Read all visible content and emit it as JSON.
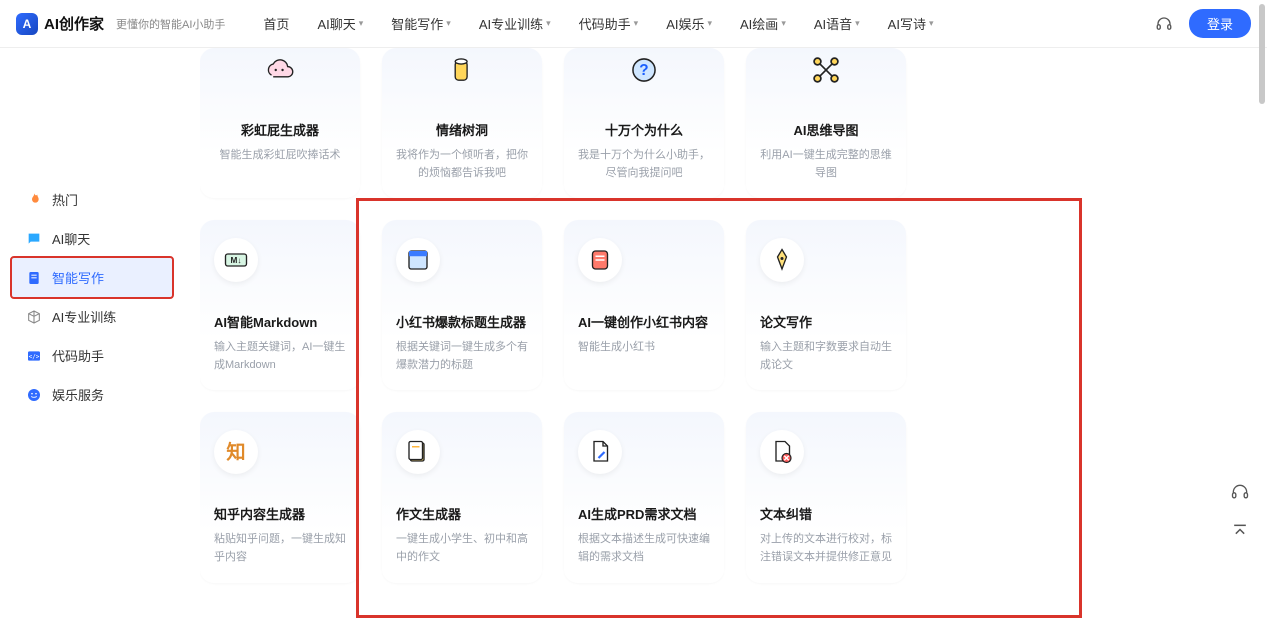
{
  "header": {
    "logo_text": "AI创作家",
    "tagline": "更懂你的智能AI小助手",
    "nav": [
      "首页",
      "AI聊天",
      "智能写作",
      "AI专业训练",
      "代码助手",
      "AI娱乐",
      "AI绘画",
      "AI语音",
      "AI写诗"
    ],
    "nav_has_dropdown": [
      false,
      true,
      true,
      true,
      true,
      true,
      true,
      true,
      true
    ],
    "login": "登录"
  },
  "sidebar": {
    "items": [
      {
        "icon": "fire",
        "label": "热门",
        "color": "#ff8a3d"
      },
      {
        "icon": "chat",
        "label": "AI聊天",
        "color": "#2aa8ff"
      },
      {
        "icon": "doc",
        "label": "智能写作",
        "color": "#2f6bff"
      },
      {
        "icon": "cube",
        "label": "AI专业训练",
        "color": "#888"
      },
      {
        "icon": "code",
        "label": "代码助手",
        "color": "#2f6bff"
      },
      {
        "icon": "smile",
        "label": "娱乐服务",
        "color": "#2f6bff"
      }
    ],
    "active_index": 2
  },
  "rows": [
    [
      {
        "icon": "cloud",
        "title": "彩虹屁生成器",
        "desc": "智能生成彩虹屁吹捧话术"
      },
      {
        "icon": "cup",
        "title": "情绪树洞",
        "desc": "我将作为一个倾听者，把你的烦恼都告诉我吧"
      },
      {
        "icon": "question",
        "title": "十万个为什么",
        "desc": "我是十万个为什么小助手，尽管向我提问吧"
      },
      {
        "icon": "mind",
        "title": "AI思维导图",
        "desc": "利用AI一键生成完整的思维导图"
      }
    ],
    [
      {
        "icon": "md",
        "title": "AI智能Markdown",
        "desc": "输入主题关键词，AI一键生成Markdown"
      },
      {
        "icon": "window",
        "title": "小红书爆款标题生成器",
        "desc": "根据关键词一键生成多个有爆款潜力的标题"
      },
      {
        "icon": "note",
        "title": "AI一键创作小红书内容",
        "desc": "智能生成小红书"
      },
      {
        "icon": "pen",
        "title": "论文写作",
        "desc": "输入主题和字数要求自动生成论文"
      }
    ],
    [
      {
        "icon": "zhi",
        "title": "知乎内容生成器",
        "desc": "粘贴知乎问题，一键生成知乎内容"
      },
      {
        "icon": "essay",
        "title": "作文生成器",
        "desc": "一键生成小学生、初中和高中的作文"
      },
      {
        "icon": "prd",
        "title": "AI生成PRD需求文档",
        "desc": "根据文本描述生成可快速编辑的需求文档"
      },
      {
        "icon": "fix",
        "title": "文本纠错",
        "desc": "对上传的文本进行校对，标注错误文本并提供修正意见"
      }
    ]
  ]
}
